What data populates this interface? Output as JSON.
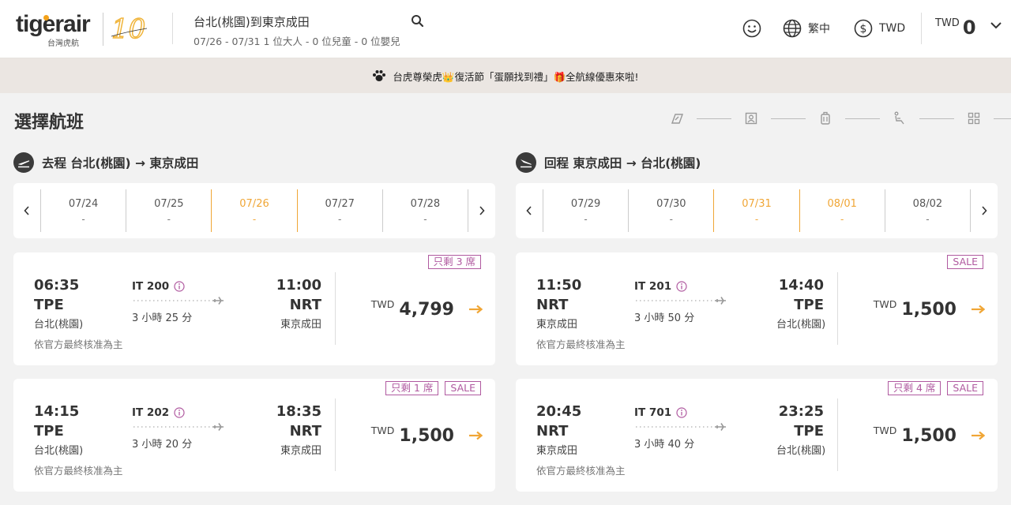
{
  "header": {
    "logo": {
      "wordmark": "tigerair",
      "subtitle": "台灣虎航",
      "anniversary": "10"
    },
    "route_title": "台北(桃園)到東京成田",
    "route_sub": "07/26 - 07/31  1 位大人 - 0 位兒童 - 0 位嬰兒",
    "search_icon": "search-icon",
    "account_icon": "smiley-icon",
    "language_label": "繁中",
    "currency_label": "TWD",
    "cart": {
      "currency": "TWD",
      "amount": "0"
    }
  },
  "banner": {
    "text": "台虎尊榮虎👑復活節「蛋願找到禮」🎁全航線優惠來啦!"
  },
  "page": {
    "title": "選擇航班"
  },
  "steps": [
    "flight-icon",
    "passenger-icon",
    "baggage-icon",
    "seat-icon",
    "extras-icon",
    "payment-icon"
  ],
  "outbound": {
    "label": "去程  台北(桃園) → 東京成田",
    "dates": [
      {
        "date": "07/24",
        "price": "-"
      },
      {
        "date": "07/25",
        "price": "-"
      },
      {
        "date": "07/26",
        "price": "-",
        "selected": true
      },
      {
        "date": "07/27",
        "price": "-"
      },
      {
        "date": "07/28",
        "price": "-"
      }
    ],
    "flights": [
      {
        "dep_time": "06:35",
        "dep_code": "TPE",
        "dep_city": "台北(桃園)",
        "flight_no": "IT 200",
        "duration": "3 小時 25 分",
        "arr_time": "11:00",
        "arr_code": "NRT",
        "arr_city": "東京成田",
        "currency": "TWD",
        "price": "4,799",
        "badges": [
          "只剩 3 席"
        ],
        "note": "依官方最終核准為主"
      },
      {
        "dep_time": "14:15",
        "dep_code": "TPE",
        "dep_city": "台北(桃園)",
        "flight_no": "IT 202",
        "duration": "3 小時 20 分",
        "arr_time": "18:35",
        "arr_code": "NRT",
        "arr_city": "東京成田",
        "currency": "TWD",
        "price": "1,500",
        "badges": [
          "只剩 1 席",
          "SALE"
        ],
        "note": "依官方最終核准為主"
      }
    ]
  },
  "inbound": {
    "label": "回程  東京成田 → 台北(桃園)",
    "dates": [
      {
        "date": "07/29",
        "price": "-"
      },
      {
        "date": "07/30",
        "price": "-"
      },
      {
        "date": "07/31",
        "price": "-",
        "selected": true
      },
      {
        "date": "08/01",
        "price": "-",
        "selected": true
      },
      {
        "date": "08/02",
        "price": "-"
      }
    ],
    "flights": [
      {
        "dep_time": "11:50",
        "dep_code": "NRT",
        "dep_city": "東京成田",
        "flight_no": "IT 201",
        "duration": "3 小時 50 分",
        "arr_time": "14:40",
        "arr_code": "TPE",
        "arr_city": "台北(桃園)",
        "currency": "TWD",
        "price": "1,500",
        "badges": [
          "SALE"
        ],
        "note": "依官方最終核准為主"
      },
      {
        "dep_time": "20:45",
        "dep_code": "NRT",
        "dep_city": "東京成田",
        "flight_no": "IT 701",
        "duration": "3 小時 40 分",
        "arr_time": "23:25",
        "arr_code": "TPE",
        "arr_city": "台北(桃園)",
        "currency": "TWD",
        "price": "1,500",
        "badges": [
          "只剩 4 席",
          "SALE"
        ],
        "note": "依官方最終核准為主"
      }
    ]
  },
  "colors": {
    "accent": "#f0a636",
    "badge": "#b05aa0",
    "banner_bg": "#ebe6e2",
    "page_bg": "#f2f2f2"
  }
}
